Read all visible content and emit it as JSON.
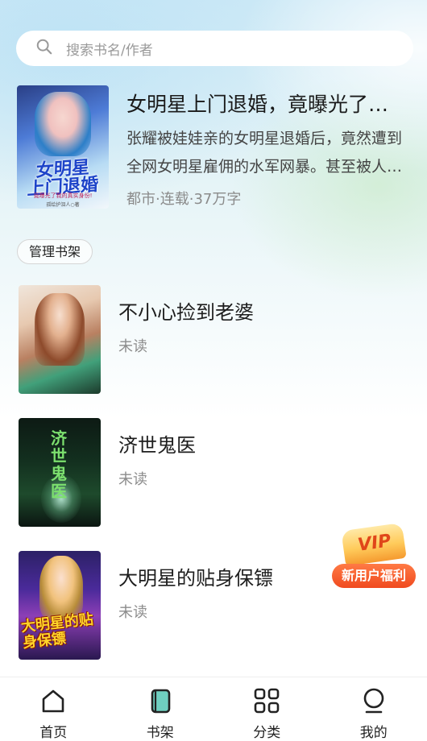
{
  "search": {
    "placeholder": "搜索书名/作者"
  },
  "featured": {
    "title": "女明星上门退婚，竟曝光了我的真实身份！",
    "description": "张耀被娃娃亲的女明星退婚后，竟然遭到全网女明星雇佣的水军网暴。甚至被人肉搜索……",
    "meta": "都市·连载·37万字",
    "cover_title_line1": "女明星",
    "cover_title_line2": "上门退婚",
    "cover_subtitle": "竟曝光了我的真实身份!",
    "cover_author": "孤绘护泪人○著"
  },
  "shelf": {
    "manage_label": "管理书架"
  },
  "books": [
    {
      "title": "不小心捡到老婆",
      "status": "未读"
    },
    {
      "title": "济世鬼医",
      "status": "未读",
      "cover_text": "济世鬼医"
    },
    {
      "title": "大明星的贴身保镖",
      "status": "未读",
      "cover_text": "大明星的贴身保镖"
    }
  ],
  "promo": {
    "vip_label": "VIP",
    "text": "新用户福利"
  },
  "nav": [
    {
      "label": "首页",
      "icon": "home-icon"
    },
    {
      "label": "书架",
      "icon": "bookshelf-icon"
    },
    {
      "label": "分类",
      "icon": "category-icon"
    },
    {
      "label": "我的",
      "icon": "profile-icon"
    }
  ],
  "colors": {
    "accent": "#6fcfc0",
    "promo": "#f04a1f",
    "bg_top": "#cde9f6"
  }
}
